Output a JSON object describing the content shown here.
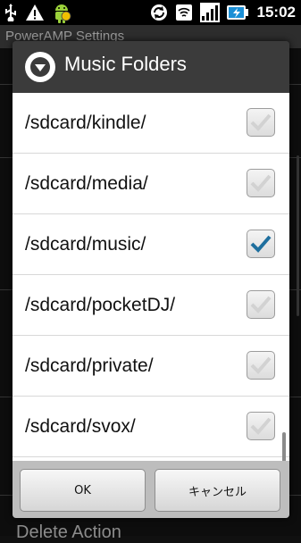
{
  "status_bar": {
    "time": "15:02",
    "icons": [
      "usb-icon",
      "warning-icon",
      "android-icon",
      "sync-icon",
      "wifi-icon",
      "signal-icon",
      "battery-charging-icon"
    ]
  },
  "background": {
    "title": "PowerAMP Settings",
    "bottom_item": "Delete Action"
  },
  "dialog": {
    "title": "Music Folders",
    "icon": "chevron-down-circle-icon",
    "items": [
      {
        "label": "/sdcard/kindle/",
        "checked": false
      },
      {
        "label": "/sdcard/media/",
        "checked": false
      },
      {
        "label": "/sdcard/music/",
        "checked": true
      },
      {
        "label": "/sdcard/pocketDJ/",
        "checked": false
      },
      {
        "label": "/sdcard/private/",
        "checked": false
      },
      {
        "label": "/sdcard/svox/",
        "checked": false
      }
    ],
    "ok_label": "OK",
    "cancel_label": "キャンセル"
  },
  "colors": {
    "check_accent": "#1f6f9e",
    "dialog_header": "#3b3b3b",
    "list_background": "#ffffff"
  }
}
